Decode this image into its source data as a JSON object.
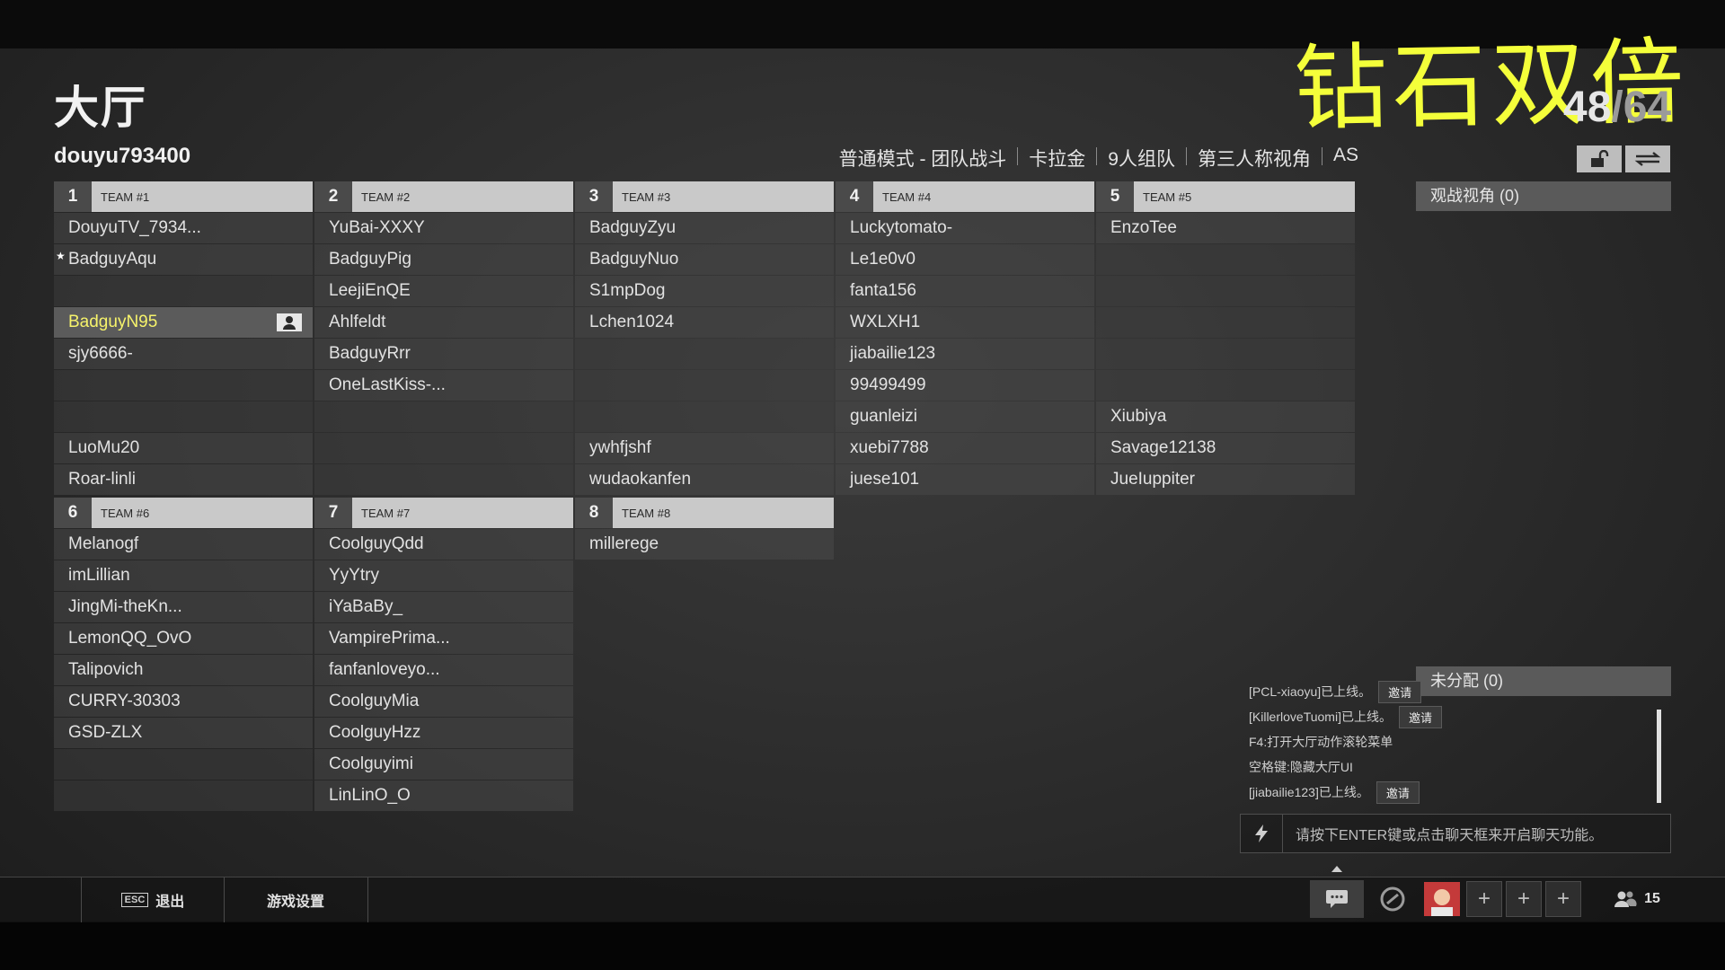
{
  "header": {
    "title": "大厅",
    "overlay_text": "钻石双倍",
    "player_count_current": "48",
    "player_count_total": "/64",
    "username": "douyu793400",
    "modes": [
      "普通模式 - 团队战斗",
      "卡拉金",
      "9人组队",
      "第三人称视角",
      "AS"
    ],
    "lock_icon": "unlock-icon",
    "swap_icon": "swap-arrows-icon"
  },
  "teams": [
    {
      "num": "1",
      "name": "TEAM #1",
      "slots": [
        "DouyuTV_7934...",
        "BadguyAqu",
        "",
        "BadguyN95",
        "sjy6666-",
        "",
        "",
        "LuoMu20",
        "Roar-linli"
      ]
    },
    {
      "num": "2",
      "name": "TEAM #2",
      "slots": [
        "YuBai-XXXY",
        "BadguyPig",
        "LeejiEnQE",
        "Ahlfeldt",
        "BadguyRrr",
        "OneLastKiss-...",
        "",
        "",
        ""
      ]
    },
    {
      "num": "3",
      "name": "TEAM #3",
      "slots": [
        "BadguyZyu",
        "BadguyNuo",
        "S1mpDog",
        "Lchen1024",
        "",
        "",
        "",
        "ywhfjshf",
        "wudaokanfen"
      ]
    },
    {
      "num": "4",
      "name": "TEAM #4",
      "slots": [
        "Luckytomato-",
        "Le1e0v0",
        "fanta156",
        "WXLXH1",
        "jiabailie123",
        "99499499",
        "guanleizi",
        "xuebi7788",
        "juese101"
      ]
    },
    {
      "num": "5",
      "name": "TEAM #5",
      "slots": [
        "EnzoTee",
        "",
        "",
        "",
        "",
        "",
        "Xiubiya",
        "Savage12138",
        "JueIuppiter"
      ]
    },
    {
      "num": "6",
      "name": "TEAM #6",
      "slots": [
        "Melanogf",
        "imLillian",
        "JingMi-theKn...",
        "LemonQQ_OvO",
        "Talipovich",
        "CURRY-30303",
        "GSD-ZLX",
        "",
        ""
      ]
    },
    {
      "num": "7",
      "name": "TEAM #7",
      "slots": [
        "CoolguyQdd",
        "YyYtry",
        "iYaBaBy_",
        "VampirePrima...",
        "fanfanloveyo...",
        "CoolguyMia",
        "CoolguyHzz",
        "Coolguyimi",
        "LinLinO_O"
      ]
    },
    {
      "num": "8",
      "name": "TEAM #8",
      "slots": [
        "millerege"
      ]
    }
  ],
  "self_player": "BadguyN95",
  "starred_player": "BadguyAqu",
  "side": {
    "spectator_label": "观战视角 (0)",
    "unassigned_label": "未分配 (0)"
  },
  "chat": {
    "lines": [
      {
        "text": "[PCL-xiaoyu]已上线。",
        "invite": "邀请"
      },
      {
        "text": "[KillerloveTuomi]已上线。",
        "invite": "邀请"
      },
      {
        "text": "F4:打开大厅动作滚轮菜单",
        "invite": ""
      },
      {
        "text": "空格键:隐藏大厅UI",
        "invite": ""
      },
      {
        "text": "[jiabailie123]已上线。",
        "invite": "邀请"
      }
    ],
    "input_hint": "请按下ENTER键或点击聊天框来开启聊天功能。"
  },
  "bottom": {
    "esc_key": "ESC",
    "exit_label": "退出",
    "settings_label": "游戏设置",
    "friends_count": "15"
  },
  "colors": {
    "self_highlight": "#f6f36b",
    "overlay_yellow": "#f4ff3a",
    "header_bg": "#c9c9c9"
  }
}
